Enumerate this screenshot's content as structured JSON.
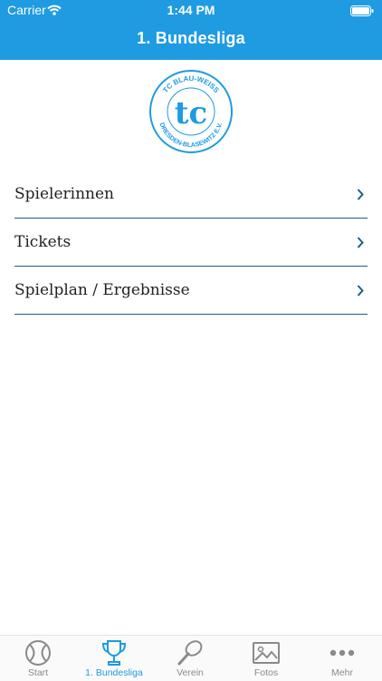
{
  "status_bar": {
    "carrier": "Carrier",
    "time": "1:44 PM"
  },
  "nav": {
    "title": "1. Bundesliga"
  },
  "logo": {
    "top_text": "TC BLAU-WEISS",
    "bottom_text": "DRESDEN-BLASEWITZ E.V.",
    "monogram": "tc",
    "color": "#1e9be1"
  },
  "menu": {
    "items": [
      {
        "label": "Spielerinnen",
        "icon": "chevron-right-icon"
      },
      {
        "label": "Tickets",
        "icon": "chevron-right-icon"
      },
      {
        "label": "Spielplan / Ergebnisse",
        "icon": "chevron-right-icon"
      }
    ]
  },
  "tabbar": {
    "tabs": [
      {
        "label": "Start",
        "icon": "tennis-ball-icon",
        "active": false
      },
      {
        "label": "1. Bundesliga",
        "icon": "trophy-icon",
        "active": true
      },
      {
        "label": "Verein",
        "icon": "tennis-racket-icon",
        "active": false
      },
      {
        "label": "Fotos",
        "icon": "photo-icon",
        "active": false
      },
      {
        "label": "Mehr",
        "icon": "more-icon",
        "active": false
      }
    ]
  },
  "colors": {
    "accent": "#1e9be1",
    "divider": "#1a5f8a",
    "inactive": "#8a8a8a"
  }
}
